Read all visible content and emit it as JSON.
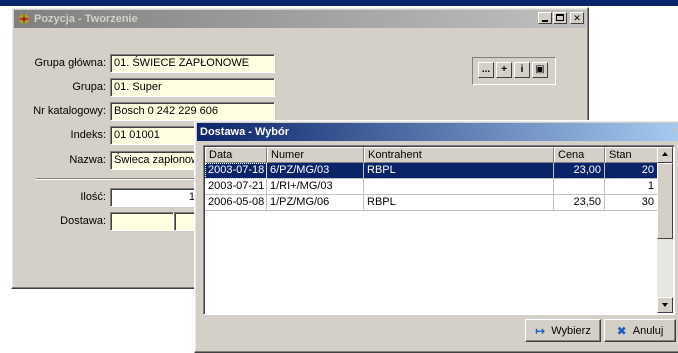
{
  "main_window": {
    "title": "Pozycja - Tworzenie",
    "labels": {
      "grupa_glowna": "Grupa główna:",
      "grupa": "Grupa:",
      "nr_katalogowy": "Nr katalogowy:",
      "indeks": "Indeks:",
      "nazwa": "Nazwa:",
      "ilosc": "Ilość:",
      "dostawa": "Dostawa:"
    },
    "values": {
      "grupa_glowna": "01. ŚWIECE ZAPŁONOWE",
      "grupa": "01. Super",
      "nr_katalogowy": "Bosch  0 242 229 606",
      "indeks": "01 01001",
      "nazwa": "Świeca zapłonow",
      "ilosc": "1"
    },
    "toolbar": [
      "...",
      "+",
      "i",
      "▣"
    ]
  },
  "dialog": {
    "title": "Dostawa - Wybór",
    "columns": [
      "Data",
      "Numer",
      "Kontrahent",
      "Cena",
      "Stan"
    ],
    "rows": [
      {
        "data": "2003-07-18",
        "numer": "6/PZ/MG/03",
        "kontrahent": "RBPL",
        "cena": "23,00",
        "stan": "20"
      },
      {
        "data": "2003-07-21",
        "numer": "1/RI+/MG/03",
        "kontrahent": "",
        "cena": "",
        "stan": "1"
      },
      {
        "data": "2006-05-08",
        "numer": "1/PZ/MG/06",
        "kontrahent": "RBPL",
        "cena": "23,50",
        "stan": "30"
      }
    ],
    "selected_row": 0,
    "buttons": {
      "select": "Wybierz",
      "cancel": "Anuluj"
    }
  },
  "colors": {
    "selection": "#0a246a",
    "input_background": "#ffffe1",
    "face": "#d4d0c8"
  }
}
